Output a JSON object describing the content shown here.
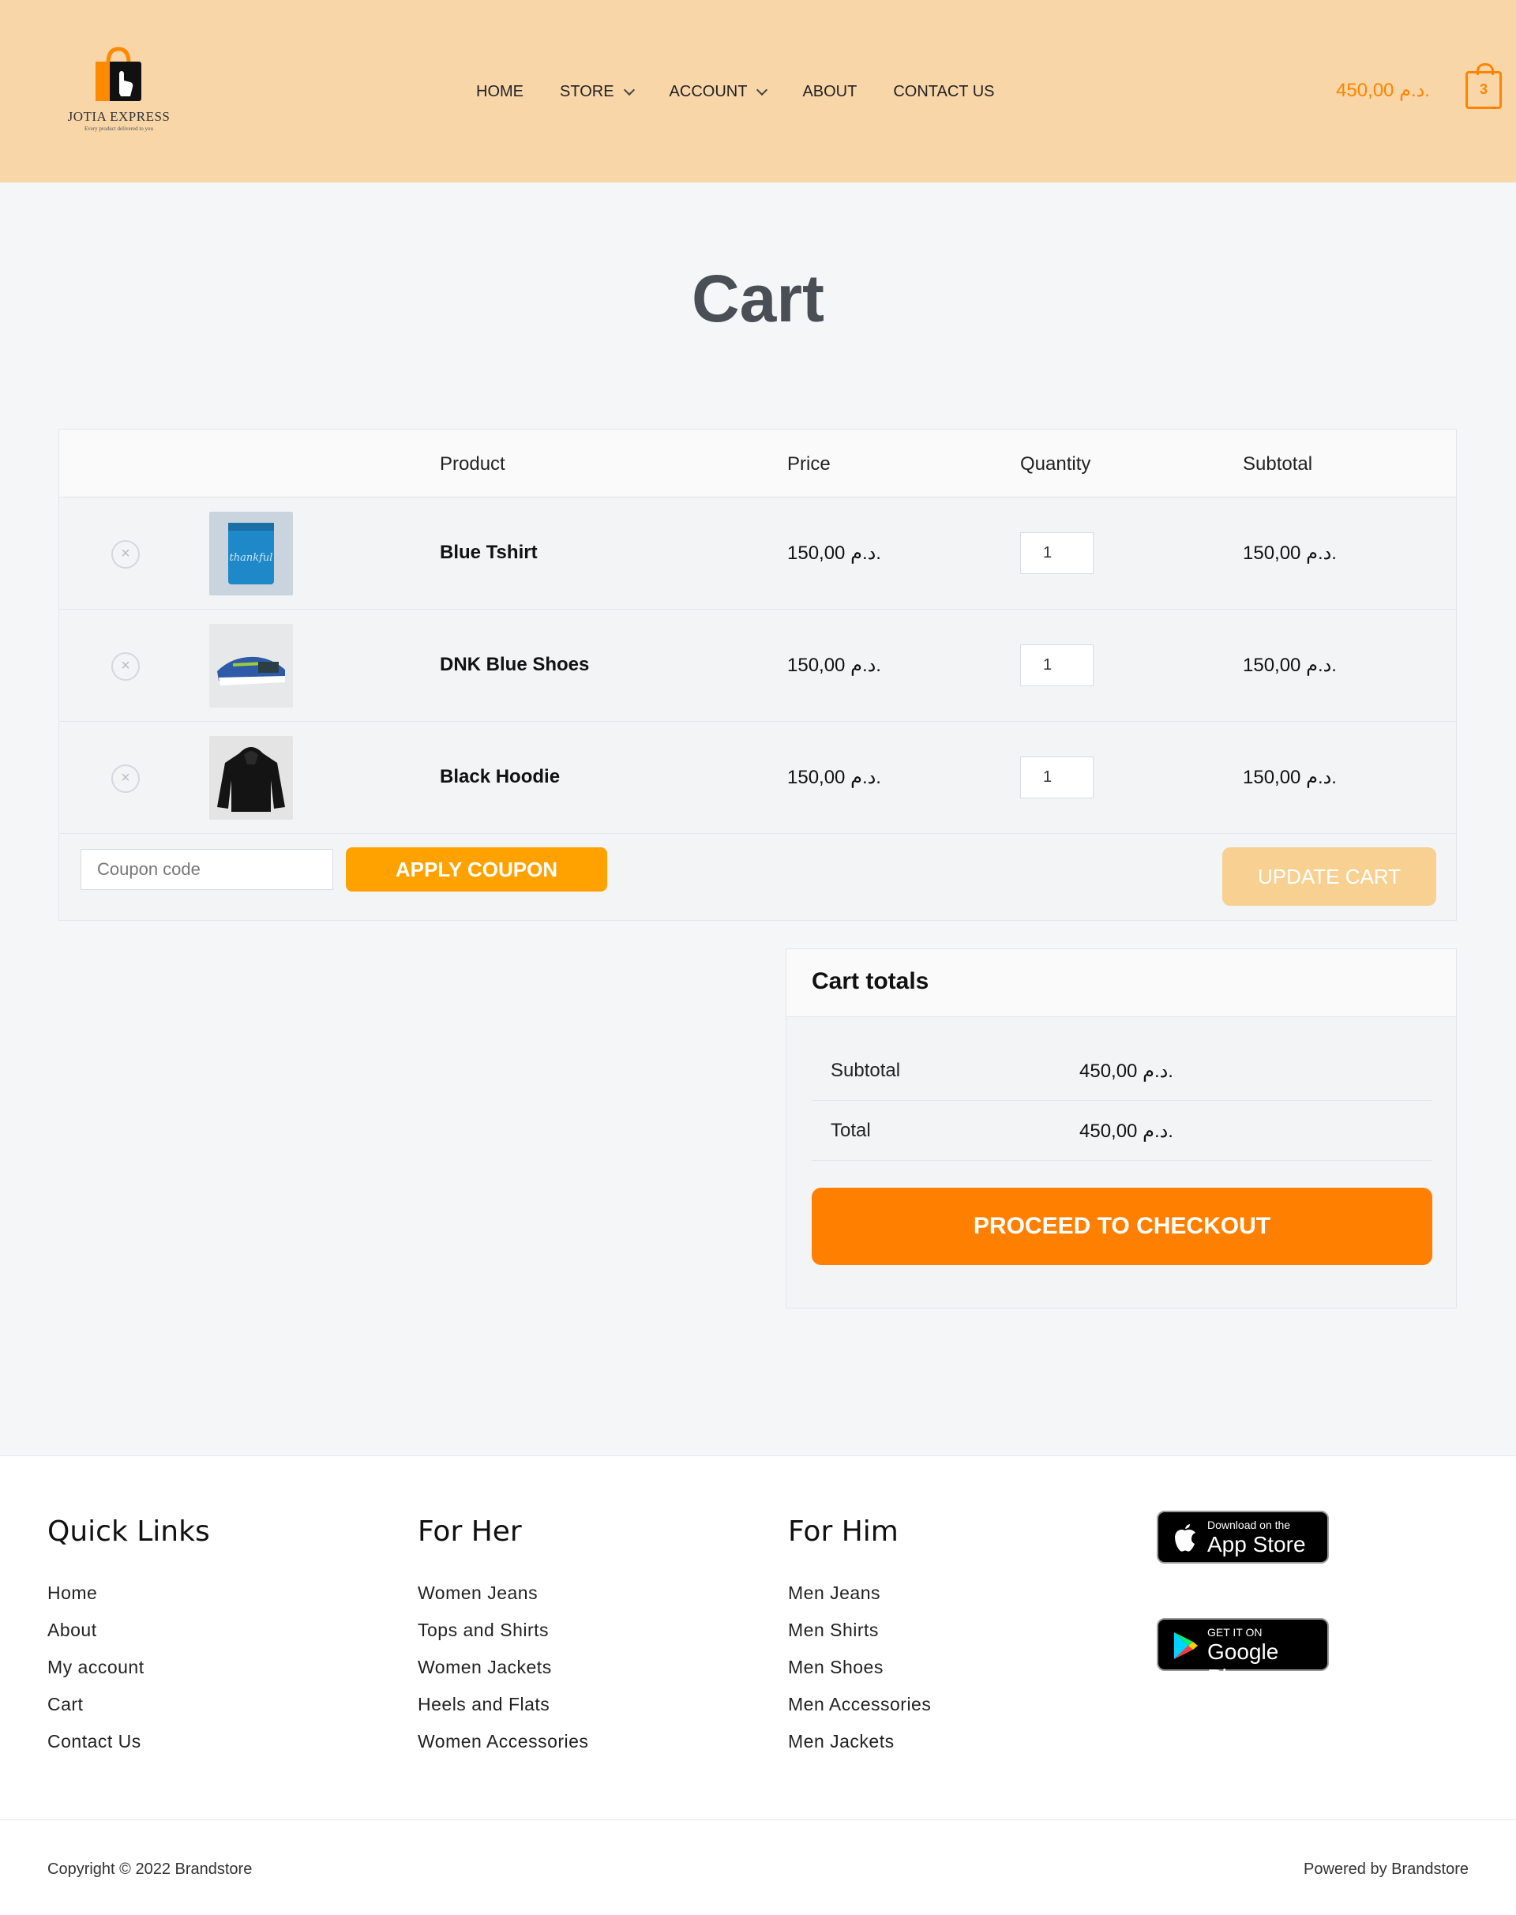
{
  "header": {
    "logo_name": "JOTIA EXPRESS",
    "logo_tagline": "Every product delivered to you",
    "nav": [
      {
        "label": "HOME",
        "has_dropdown": false
      },
      {
        "label": "STORE",
        "has_dropdown": true
      },
      {
        "label": "ACCOUNT",
        "has_dropdown": true
      },
      {
        "label": "ABOUT",
        "has_dropdown": false
      },
      {
        "label": "CONTACT US",
        "has_dropdown": false
      }
    ],
    "cart_total": "450,00 د.م.",
    "cart_count": "3",
    "accent_color": "#ff8400",
    "background_color": "#f8d6a8"
  },
  "page_title": "Cart",
  "cart": {
    "columns": [
      "",
      "",
      "Product",
      "Price",
      "Quantity",
      "Subtotal"
    ],
    "items": [
      {
        "name": "Blue Tshirt",
        "price": "150,00 د.م.",
        "quantity": "1",
        "subtotal": "150,00 د.م.",
        "thumb_icon": "blue-tshirt-image"
      },
      {
        "name": "DNK Blue Shoes",
        "price": "150,00 د.م.",
        "quantity": "1",
        "subtotal": "150,00 د.م.",
        "thumb_icon": "blue-shoes-image"
      },
      {
        "name": "Black Hoodie",
        "price": "150,00 د.م.",
        "quantity": "1",
        "subtotal": "150,00 د.م.",
        "thumb_icon": "black-hoodie-image"
      }
    ],
    "coupon_placeholder": "Coupon code",
    "apply_coupon_label": "APPLY COUPON",
    "update_cart_label": "UPDATE CART"
  },
  "totals": {
    "title": "Cart totals",
    "subtotal_label": "Subtotal",
    "subtotal_value": "450,00 د.م.",
    "total_label": "Total",
    "total_value": "450,00 د.م.",
    "checkout_label": "PROCEED TO CHECKOUT"
  },
  "footer": {
    "columns": [
      {
        "title": "Quick Links",
        "links": [
          "Home",
          "About",
          "My account",
          "Cart",
          "Contact Us"
        ]
      },
      {
        "title": "For Her",
        "links": [
          "Women Jeans",
          "Tops and Shirts",
          "Women Jackets",
          "Heels and Flats",
          "Women Accessories"
        ]
      },
      {
        "title": "For Him",
        "links": [
          "Men Jeans",
          "Men Shirts",
          "Men Shoes",
          "Men Accessories",
          "Men Jackets"
        ]
      }
    ],
    "app_store": {
      "small": "Download on the",
      "big": "App Store"
    },
    "google_play": {
      "small": "GET IT ON",
      "big": "Google Play"
    },
    "copyright": "Copyright © 2022 Brandstore",
    "powered_by": "Powered by Brandstore"
  }
}
